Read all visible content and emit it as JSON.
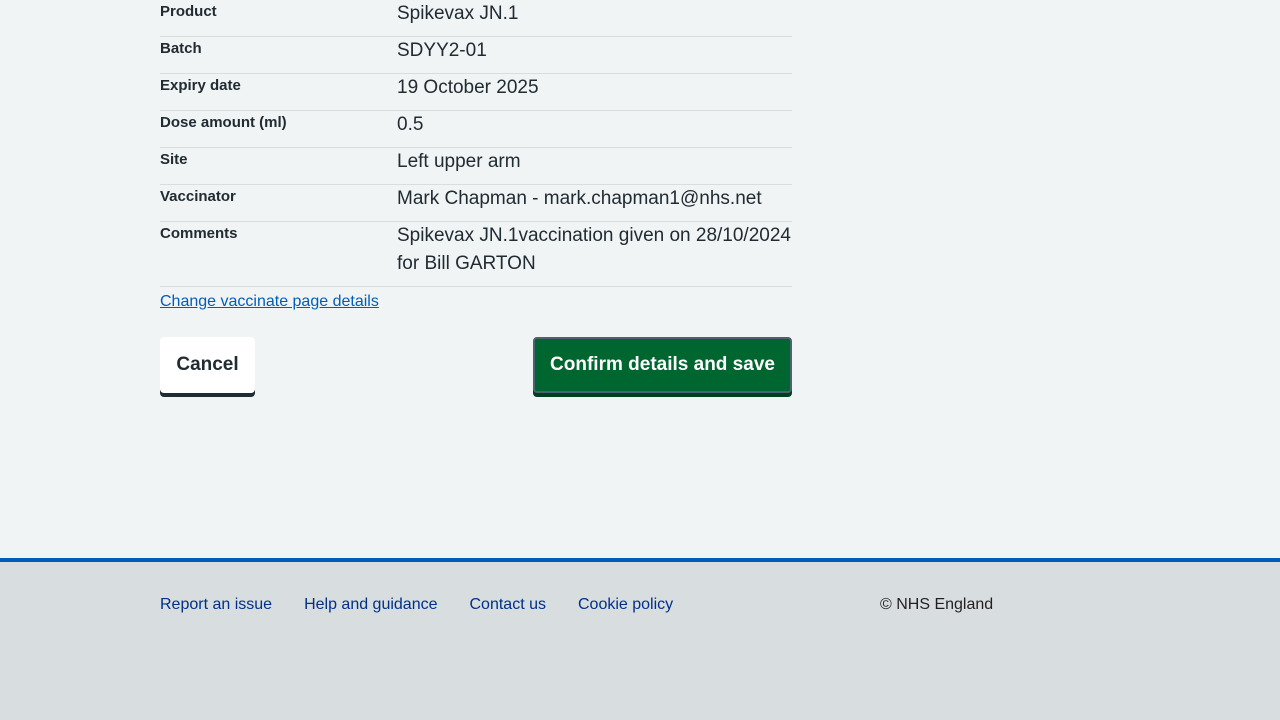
{
  "summary": {
    "rows": [
      {
        "key": "Product",
        "value": "Spikevax JN.1"
      },
      {
        "key": "Batch",
        "value": "SDYY2-01"
      },
      {
        "key": "Expiry date",
        "value": "19 October 2025"
      },
      {
        "key": "Dose amount (ml)",
        "value": "0.5"
      },
      {
        "key": "Site",
        "value": "Left upper arm"
      },
      {
        "key": "Vaccinator",
        "value": "Mark Chapman - mark.chapman1@nhs.net"
      },
      {
        "key": "Comments",
        "value": "Spikevax JN.1vaccination given on 28/10/2024 for Bill GARTON"
      }
    ]
  },
  "change_link": "Change vaccinate page details",
  "actions": {
    "cancel_label": "Cancel",
    "confirm_label": "Confirm details and save"
  },
  "footer": {
    "links": [
      "Report an issue",
      "Help and guidance",
      "Contact us",
      "Cookie policy"
    ],
    "copyright": "© NHS England"
  },
  "colors": {
    "link": "#005eb8",
    "confirm_button": "#00662f",
    "footer_border": "#005eb8",
    "footer_link": "#003087"
  }
}
